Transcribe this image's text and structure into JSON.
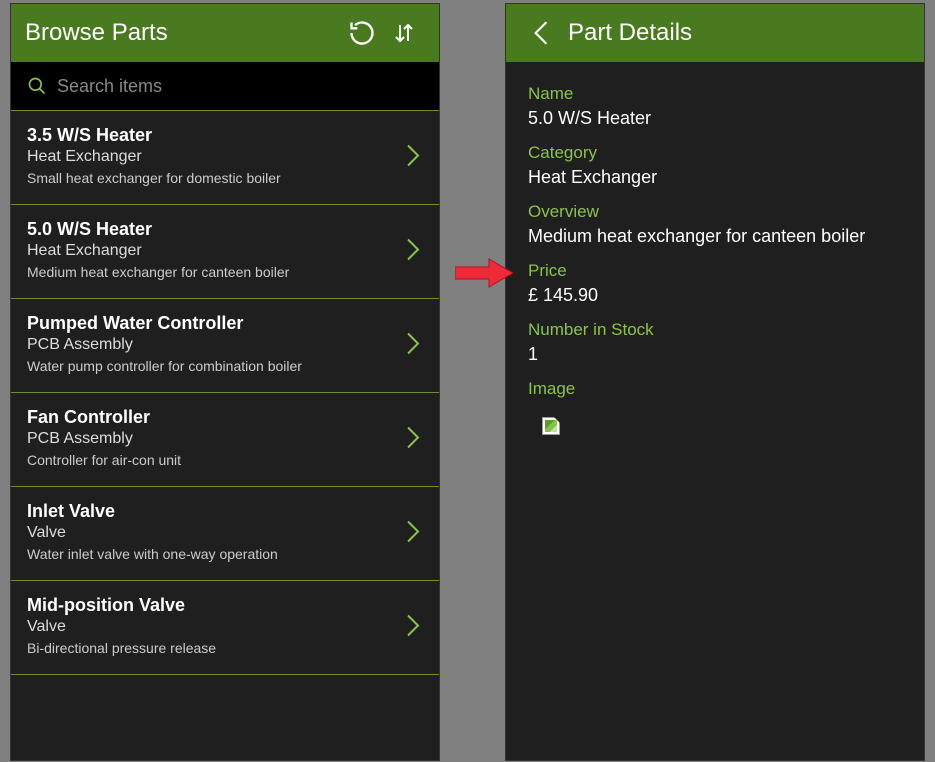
{
  "leftPanel": {
    "title": "Browse Parts",
    "searchPlaceholder": "Search items",
    "items": [
      {
        "name": "3.5 W/S Heater",
        "category": "Heat Exchanger",
        "desc": "Small heat exchanger for domestic boiler"
      },
      {
        "name": "5.0 W/S Heater",
        "category": "Heat Exchanger",
        "desc": "Medium  heat exchanger for canteen boiler"
      },
      {
        "name": "Pumped Water Controller",
        "category": "PCB Assembly",
        "desc": "Water pump controller for combination boiler"
      },
      {
        "name": "Fan Controller",
        "category": "PCB Assembly",
        "desc": "Controller for air-con unit"
      },
      {
        "name": "Inlet Valve",
        "category": "Valve",
        "desc": "Water inlet valve with one-way operation"
      },
      {
        "name": "Mid-position Valve",
        "category": "Valve",
        "desc": "Bi-directional pressure release"
      }
    ]
  },
  "rightPanel": {
    "title": "Part Details",
    "labels": {
      "name": "Name",
      "category": "Category",
      "overview": "Overview",
      "price": "Price",
      "stock": "Number in Stock",
      "image": "Image"
    },
    "values": {
      "name": "5.0 W/S Heater",
      "category": "Heat Exchanger",
      "overview": "Medium  heat exchanger for canteen boiler",
      "price": "£ 145.90",
      "stock": "1"
    }
  }
}
